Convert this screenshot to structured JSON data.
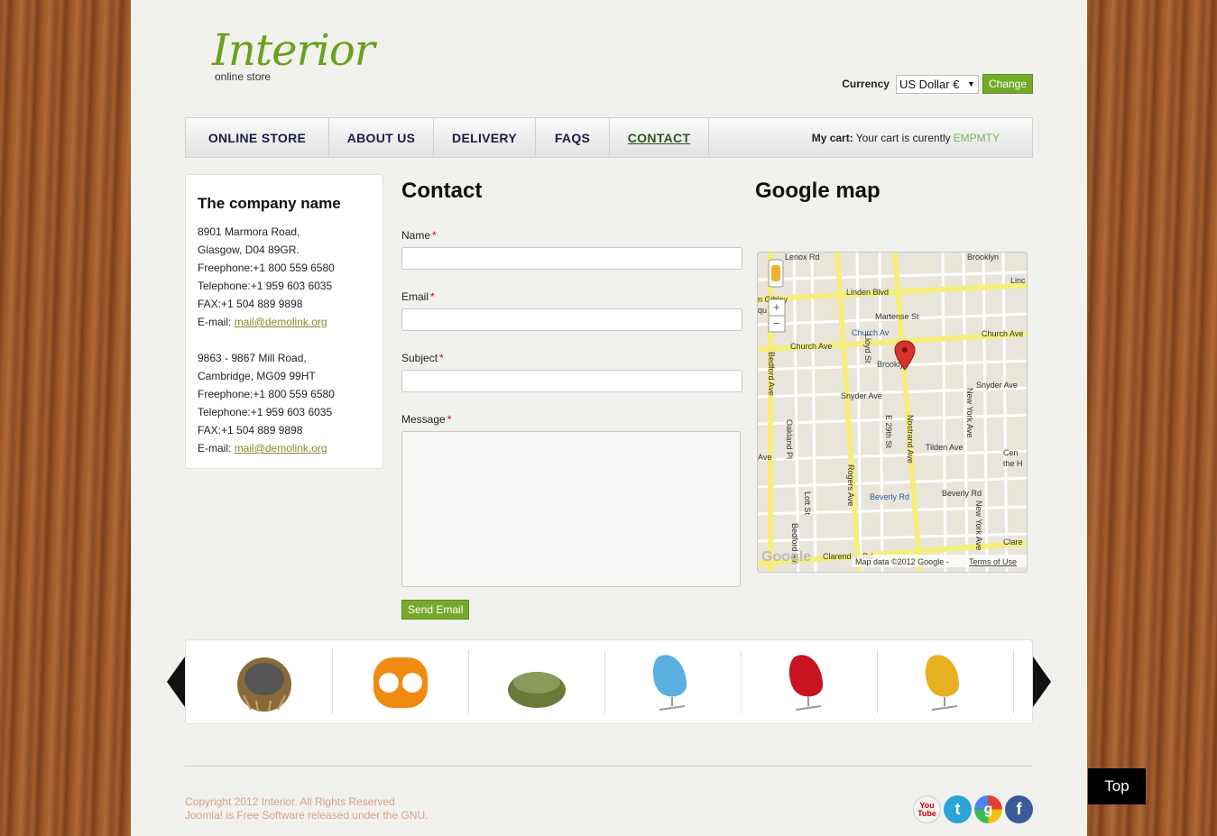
{
  "logo": {
    "name": "Interior",
    "tagline": "online store"
  },
  "currency": {
    "label": "Currency",
    "selected": "US Dollar €",
    "button": "Change"
  },
  "nav": {
    "items": [
      {
        "label": "ONLINE STORE"
      },
      {
        "label": "ABOUT US"
      },
      {
        "label": "DELIVERY"
      },
      {
        "label": "FAQS"
      },
      {
        "label": "CONTACT"
      }
    ]
  },
  "cart": {
    "label": "My cart:",
    "text": "Your cart is curently",
    "status": "EMPMTY"
  },
  "company": {
    "title": "The company name",
    "address1": {
      "street": "8901 Marmora Road,",
      "city": "Glasgow, D04 89GR.",
      "freephone": "Freephone:+1 800 559 6580",
      "telephone": "Telephone:+1 959 603 6035",
      "fax": "FAX:+1 504 889 9898",
      "email_label": "E-mail:",
      "email": "mail@demolink.org"
    },
    "address2": {
      "street": "9863 - 9867 Mill Road,",
      "city": "Cambridge, MG09 99HT",
      "freephone": "Freephone:+1 800 559 6580",
      "telephone": "Telephone:+1 959 603 6035",
      "fax": "FAX:+1 504 889 9898",
      "email_label": "E-mail:",
      "email": "mail@demolink.org"
    }
  },
  "contact": {
    "title": "Contact",
    "name_label": "Name",
    "email_label": "Email",
    "subject_label": "Subject",
    "message_label": "Message",
    "required_mark": "*",
    "submit": "Send Email"
  },
  "map": {
    "title": "Google map",
    "labels": {
      "lenox": "Lenox Rd",
      "brooklyn": "Brooklyn",
      "linden": "Linden Blvd",
      "lincoln": "Linc",
      "martense": "Martense St",
      "church_av": "Church Av",
      "church_ave_left": "Church Ave",
      "church_ave_right": "Church Ave",
      "lloyd": "Lloyd St",
      "brooklyn_town": "Brooklyn",
      "snyder_left": "Snyder Ave",
      "snyder_right": "Snyder Ave",
      "bedford": "Bedford Ave",
      "oakland": "Oakland Pl",
      "e29": "E 29th St",
      "nostrand": "Nostrand Ave",
      "tilden": "Tilden Ave",
      "new_york": "New York Ave",
      "center": "Cen",
      "the_h": "the H",
      "rogers": "Rogers Ave",
      "beverly_rd": "Beverly Rd",
      "beverly": "Beverly Rd",
      "lott": "Lott St",
      "clarendon": "Clarendon Rd",
      "clare": "Clare",
      "ave_left": "Ave",
      "bedford_bottom": "Bedford Av",
      "gibley": "n Gibley",
      "qu": "qu"
    },
    "attribution": "Map data ©2012 Google -",
    "terms": "Terms of Use",
    "google": "Google"
  },
  "carousel": {
    "items": [
      {
        "name": "wicker-round-chair",
        "color": "#8a6a3a"
      },
      {
        "name": "orange-cube-seat",
        "color": "#f08a10"
      },
      {
        "name": "green-round-sofa",
        "color": "#6a7a3a"
      },
      {
        "name": "blue-egg-chair",
        "color": "#5ab0e0"
      },
      {
        "name": "red-egg-chair",
        "color": "#c81420"
      },
      {
        "name": "yellow-egg-chair",
        "color": "#e6b020"
      }
    ]
  },
  "footer": {
    "copyright": "Copyright 2012 Interior. All Rights Reserved",
    "joomla": "Joomla! is Free Software released under the GNU."
  },
  "social": [
    {
      "name": "youtube",
      "text": "You\nTube",
      "color": "#ffffff"
    },
    {
      "name": "twitter",
      "text": "t",
      "color": "#2aa3d6"
    },
    {
      "name": "google",
      "text": "g",
      "color": "#e04030"
    },
    {
      "name": "facebook",
      "text": "f",
      "color": "#3b5a9a"
    }
  ],
  "top_button": "Top"
}
